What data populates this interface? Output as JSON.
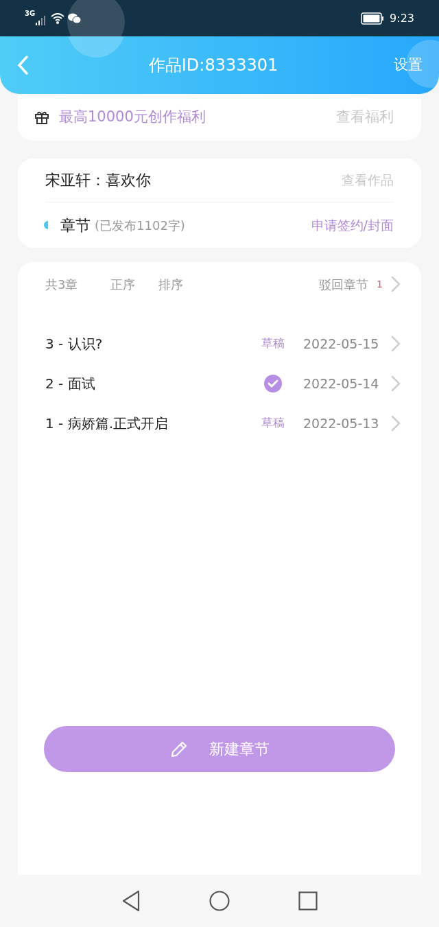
{
  "status_bar": {
    "network": "3G",
    "time": "9:23"
  },
  "header": {
    "title": "作品ID:8333301",
    "action": "设置"
  },
  "benefit": {
    "text": "最高10000元创作福利",
    "link": "查看福利"
  },
  "work": {
    "title": "宋亚轩：喜欢你",
    "link": "查看作品",
    "section": "章节",
    "count": "(已发布1102字)",
    "action": "申请签约/封面"
  },
  "chapters": {
    "total": "共3章",
    "order": "正序",
    "sort": "排序",
    "rejected": "驳回章节",
    "rejected_count": "1",
    "items": [
      {
        "title": "3 - 认识?",
        "status": {
          "kind": "draft",
          "label": "草稿"
        },
        "date": "2022-05-15"
      },
      {
        "title": "2 - 面试",
        "status": {
          "kind": "published"
        },
        "date": "2022-05-14"
      },
      {
        "title": "1 - 病娇篇.正式开启",
        "status": {
          "kind": "draft",
          "label": "草稿"
        },
        "date": "2022-05-13"
      }
    ]
  },
  "new_button": "新建章节"
}
